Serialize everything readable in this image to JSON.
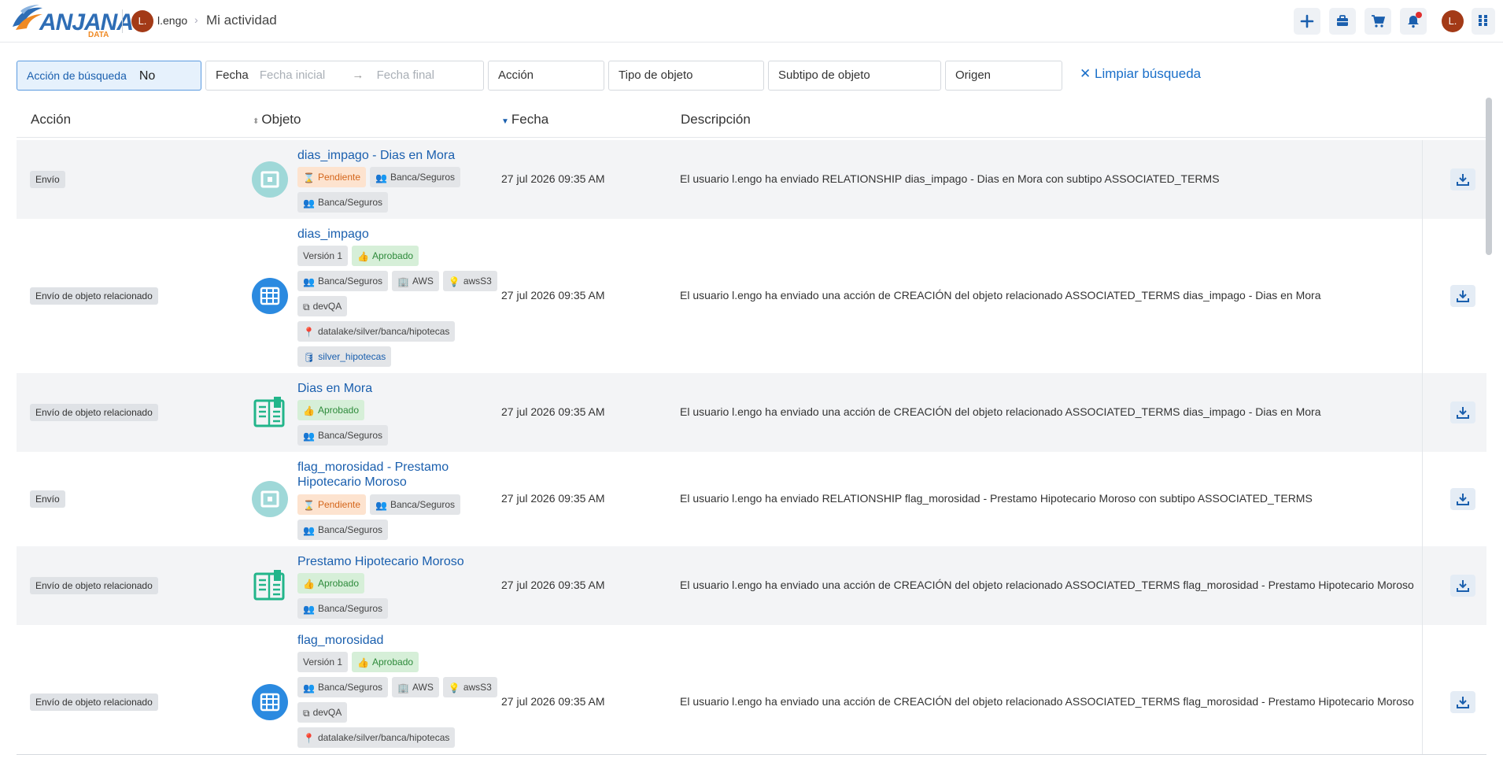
{
  "header": {
    "logo_text": "ANJANA",
    "logo_sub": "DATA",
    "user_initial": "L.",
    "user_name": "l.engo",
    "page_title": "Mi actividad",
    "actions": [
      "plus-icon",
      "briefcase-icon",
      "cart-icon",
      "bell-icon",
      "avatar",
      "apps-grid-icon"
    ],
    "avatar_initial": "L."
  },
  "filters": {
    "search_action_label": "Acción de búsqueda",
    "search_action_value": "No",
    "date_label": "Fecha",
    "date_start_placeholder": "Fecha inicial",
    "date_end_placeholder": "Fecha final",
    "action_placeholder": "Acción",
    "object_type_placeholder": "Tipo de objeto",
    "object_subtype_placeholder": "Subtipo de objeto",
    "origin_placeholder": "Origen",
    "clear_label": "Limpiar búsqueda"
  },
  "table": {
    "columns": [
      "Acción",
      "Objeto",
      "Fecha",
      "Descripción"
    ],
    "rows": [
      {
        "action": "Envío",
        "icon": "relationship-icon",
        "title": "dias_impago - Dias en Mora",
        "chips": [
          {
            "type": "pend",
            "icon": "hourglass-icon",
            "text": "Pendiente"
          },
          {
            "type": "plain",
            "icon": "users-icon",
            "text": "Banca/Seguros"
          },
          {
            "type": "plain",
            "icon": "users-icon",
            "text": "Banca/Seguros"
          }
        ],
        "date": "27 jul 2026 09:35 AM",
        "description": "El usuario l.engo ha enviado RELATIONSHIP dias_impago - Dias en Mora con subtipo ASSOCIATED_TERMS"
      },
      {
        "action": "Envío de objeto relacionado",
        "icon": "table-icon",
        "title": "dias_impago",
        "chips": [
          {
            "type": "plain",
            "icon": "",
            "text": "Versión 1"
          },
          {
            "type": "appr",
            "icon": "thumbs-up-icon",
            "text": "Aprobado"
          },
          {
            "type": "plain",
            "icon": "users-icon",
            "text": "Banca/Seguros"
          },
          {
            "type": "plain",
            "icon": "building-icon",
            "text": "AWS"
          },
          {
            "type": "plain",
            "icon": "bulb-icon",
            "text": "awsS3"
          },
          {
            "type": "plain",
            "icon": "network-icon",
            "text": "devQA"
          },
          {
            "type": "plain",
            "icon": "pin-icon",
            "text": "datalake/silver/banca/hipotecas"
          },
          {
            "type": "link",
            "icon": "database-icon",
            "text": "silver_hipotecas"
          }
        ],
        "date": "27 jul 2026 09:35 AM",
        "description": "El usuario l.engo ha enviado una acción de CREACIÓN del objeto relacionado ASSOCIATED_TERMS dias_impago - Dias en Mora"
      },
      {
        "action": "Envío de objeto relacionado",
        "icon": "glossary-icon",
        "title": "Dias en Mora",
        "chips": [
          {
            "type": "appr",
            "icon": "thumbs-up-icon",
            "text": "Aprobado"
          },
          {
            "type": "plain",
            "icon": "users-icon",
            "text": "Banca/Seguros"
          }
        ],
        "date": "27 jul 2026 09:35 AM",
        "description": "El usuario l.engo ha enviado una acción de CREACIÓN del objeto relacionado ASSOCIATED_TERMS dias_impago - Dias en Mora"
      },
      {
        "action": "Envío",
        "icon": "relationship-icon",
        "title": "flag_morosidad - Prestamo Hipotecario Moroso",
        "chips": [
          {
            "type": "pend",
            "icon": "hourglass-icon",
            "text": "Pendiente"
          },
          {
            "type": "plain",
            "icon": "users-icon",
            "text": "Banca/Seguros"
          },
          {
            "type": "plain",
            "icon": "users-icon",
            "text": "Banca/Seguros"
          }
        ],
        "date": "27 jul 2026 09:35 AM",
        "description": "El usuario l.engo ha enviado RELATIONSHIP flag_morosidad - Prestamo Hipotecario Moroso con subtipo ASSOCIATED_TERMS"
      },
      {
        "action": "Envío de objeto relacionado",
        "icon": "glossary-icon",
        "title": "Prestamo Hipotecario Moroso",
        "chips": [
          {
            "type": "appr",
            "icon": "thumbs-up-icon",
            "text": "Aprobado"
          },
          {
            "type": "plain",
            "icon": "users-icon",
            "text": "Banca/Seguros"
          }
        ],
        "date": "27 jul 2026 09:35 AM",
        "description": "El usuario l.engo ha enviado una acción de CREACIÓN del objeto relacionado ASSOCIATED_TERMS flag_morosidad - Prestamo Hipotecario Moroso"
      },
      {
        "action": "Envío de objeto relacionado",
        "icon": "table-icon",
        "title": "flag_morosidad",
        "chips": [
          {
            "type": "plain",
            "icon": "",
            "text": "Versión 1"
          },
          {
            "type": "appr",
            "icon": "thumbs-up-icon",
            "text": "Aprobado"
          },
          {
            "type": "plain",
            "icon": "users-icon",
            "text": "Banca/Seguros"
          },
          {
            "type": "plain",
            "icon": "building-icon",
            "text": "AWS"
          },
          {
            "type": "plain",
            "icon": "bulb-icon",
            "text": "awsS3"
          },
          {
            "type": "plain",
            "icon": "network-icon",
            "text": "devQA"
          },
          {
            "type": "plain",
            "icon": "pin-icon",
            "text": "datalake/silver/banca/hipotecas"
          }
        ],
        "date": "27 jul 2026 09:35 AM",
        "description": "El usuario l.engo ha enviado una acción de CREACIÓN del objeto relacionado ASSOCIATED_TERMS flag_morosidad - Prestamo Hipotecario Moroso"
      }
    ]
  },
  "colors": {
    "accent": "#1a5fae",
    "pending": "#d4651a",
    "approved": "#2d8a3a",
    "row_alt": "#f3f4f6"
  }
}
